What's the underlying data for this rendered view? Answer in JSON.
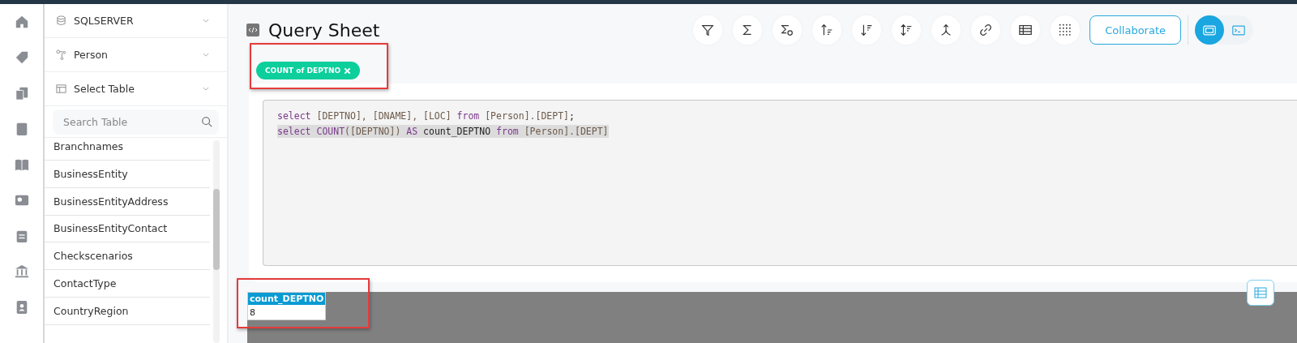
{
  "sidebar": {
    "selectors": [
      {
        "kind": "database",
        "label": "SQLSERVER"
      },
      {
        "kind": "schema",
        "label": "Person"
      },
      {
        "kind": "table",
        "label": "Select Table"
      }
    ],
    "search": {
      "placeholder": "Search Table"
    },
    "tables": [
      "Branchnames",
      "BusinessEntity",
      "BusinessEntityAddress",
      "BusinessEntityContact",
      "Checkscenarios",
      "ContactType",
      "CountryRegion"
    ]
  },
  "header": {
    "title": "Query Sheet",
    "collaborate": "Collaborate",
    "views": [
      {
        "kind": "canvas",
        "selected": true
      },
      {
        "kind": "terminal",
        "selected": false
      }
    ]
  },
  "chips": [
    {
      "label": "COUNT of DEPTNO"
    }
  ],
  "editor": {
    "lines": [
      {
        "highlighted": false,
        "tokens": [
          {
            "kind": "keyword",
            "text": "select "
          },
          {
            "kind": "ident",
            "text": "[DEPTNO], [DNAME], [LOC] "
          },
          {
            "kind": "keyword",
            "text": "from "
          },
          {
            "kind": "ident",
            "text": "[Person].[DEPT]"
          },
          {
            "kind": "plain",
            "text": ";"
          }
        ]
      },
      {
        "highlighted": true,
        "tokens": [
          {
            "kind": "keyword",
            "text": "select COUNT"
          },
          {
            "kind": "ident",
            "text": "([DEPTNO]) "
          },
          {
            "kind": "keyword",
            "text": "AS"
          },
          {
            "kind": "plain",
            "text": " count_DEPTNO "
          },
          {
            "kind": "keyword",
            "text": "from "
          },
          {
            "kind": "ident",
            "text": "[Person].[DEPT]"
          }
        ]
      }
    ]
  },
  "results": {
    "columns": [
      "count_DEPTNO"
    ],
    "rows": [
      [
        "8"
      ]
    ]
  }
}
